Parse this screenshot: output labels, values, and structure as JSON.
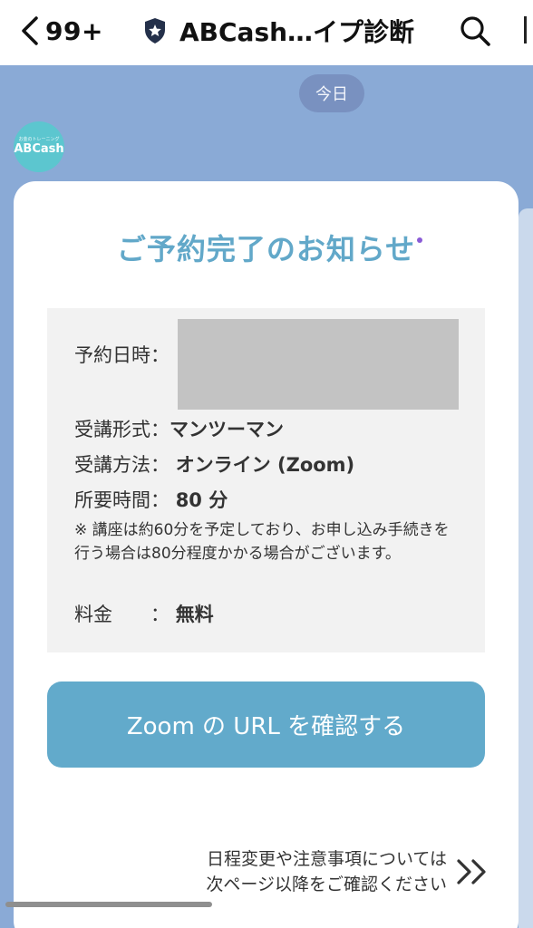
{
  "header": {
    "back_count": "99+",
    "title": "ABCash…イプ診断",
    "back_icon": "chevron-left-icon",
    "badge_icon": "shield-star-icon",
    "search_icon": "search-icon"
  },
  "chat": {
    "date_label": "今日",
    "avatar": {
      "logo": "ABCash",
      "tagline": "お金のトレーニング"
    }
  },
  "message": {
    "title": "ご予約完了のお知らせ",
    "details": {
      "datetime_label": "予約日時：",
      "format_label": "受講形式：",
      "format_value": "マンツーマン",
      "method_label": "受講方法：",
      "method_value": "オンライン (Zoom)",
      "duration_label": "所要時間：",
      "duration_value": "80 分",
      "note": "※ 講座は約60分を予定しており、お申し込み手続きを行う場合は80分程度かかる場合がございます。",
      "fee_label": "料金　　：",
      "fee_value": "無料"
    },
    "button_label": "Zoom の URL を確認する",
    "footer_line1": "日程変更や注意事項については",
    "footer_line2": "次ページ以降をご確認ください",
    "next_icon": "double-chevron-right-icon"
  },
  "colors": {
    "chat_background": "#8aaad6",
    "accent": "#62a8c9",
    "button": "#62aacb",
    "date_chip": "#7991c0",
    "avatar": "#5cc6cf"
  }
}
